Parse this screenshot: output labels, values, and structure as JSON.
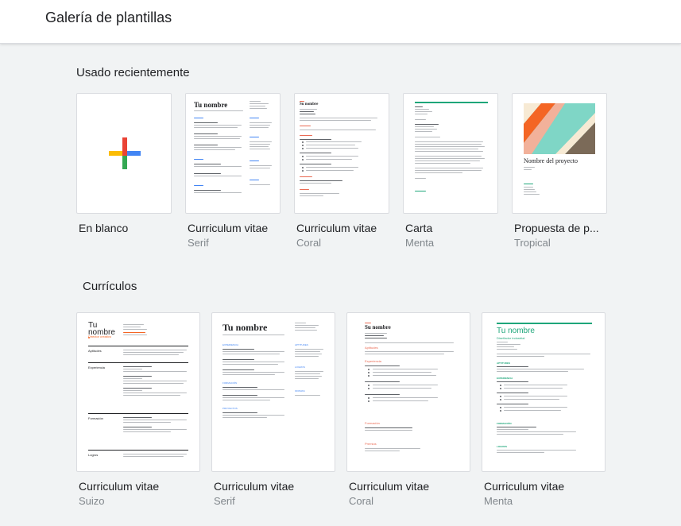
{
  "header": {
    "title": "Galería de plantillas"
  },
  "recent": {
    "title": "Usado recientemente",
    "cards": [
      {
        "name": "En blanco",
        "subtitle": ""
      },
      {
        "name": "Curriculum vitae",
        "subtitle": "Serif"
      },
      {
        "name": "Curriculum vitae",
        "subtitle": "Coral"
      },
      {
        "name": "Carta",
        "subtitle": "Menta"
      },
      {
        "name": "Propuesta de p...",
        "subtitle": "Tropical"
      }
    ]
  },
  "curriculos": {
    "title": "Currículos",
    "cards": [
      {
        "name": "Curriculum vitae",
        "subtitle": "Suizo"
      },
      {
        "name": "Curriculum vitae",
        "subtitle": "Serif"
      },
      {
        "name": "Curriculum vitae",
        "subtitle": "Coral"
      },
      {
        "name": "Curriculum vitae",
        "subtitle": "Menta"
      }
    ]
  },
  "thumb_text": {
    "tu_nombre": "Tu nombre",
    "tu_nombre_line1": "Tu",
    "tu_nombre_line2": "nombre",
    "su_nombre": "Su nombre",
    "nombre_proyecto": "Nombre del proyecto",
    "suizo_subtitle": "Director creativo",
    "suizo_sections": [
      "Aptitudes",
      "Experiencia",
      "Formación",
      "Logros"
    ],
    "menta_subtitle": "Diseñador industrial",
    "menta_sections": [
      "APTITUDES",
      "EXPERIENCIA",
      "FORMACIÓN",
      "LOGROS"
    ],
    "serif_sections": [
      "EXPERIENCIA",
      "FORMACIÓN",
      "PROYECTOS",
      "APTITUDES",
      "LOGROS",
      "IDIOMAS"
    ],
    "coral_sections": [
      "Aptitudes",
      "Experiencia",
      "Formación",
      "Premios"
    ]
  },
  "colors": {
    "accent_blue": "#4285f4",
    "accent_red": "#ea4335",
    "accent_yellow": "#fbbc04",
    "accent_green": "#34a853",
    "coral": "#ea6b54",
    "mint": "#1ea67a",
    "tropical_teal": "#7fd6c6",
    "tropical_orange": "#f46524",
    "tropical_brown": "#7b6a58"
  }
}
